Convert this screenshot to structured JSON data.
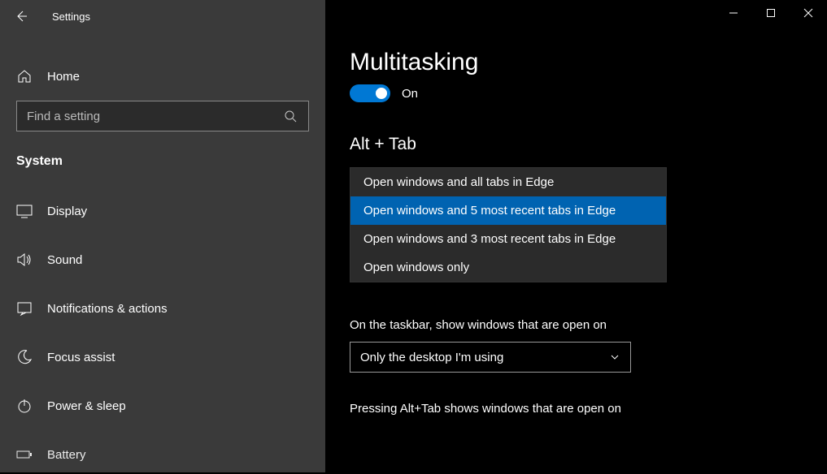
{
  "app": {
    "title": "Settings"
  },
  "sidebar": {
    "home": "Home",
    "searchPlaceholder": "Find a setting",
    "category": "System",
    "items": [
      {
        "label": "Display"
      },
      {
        "label": "Sound"
      },
      {
        "label": "Notifications & actions"
      },
      {
        "label": "Focus assist"
      },
      {
        "label": "Power & sleep"
      },
      {
        "label": "Battery"
      }
    ]
  },
  "main": {
    "title": "Multitasking",
    "toggleState": "On",
    "altTab": {
      "heading": "Alt + Tab",
      "options": [
        "Open windows and all tabs in Edge",
        "Open windows and 5 most recent tabs in Edge",
        "Open windows and 3 most recent tabs in Edge",
        "Open windows only"
      ],
      "selectedIndex": 1
    },
    "virtualDesktops": {
      "taskbarLabel": "On the taskbar, show windows that are open on",
      "taskbarValue": "Only the desktop I'm using",
      "altTabLabel": "Pressing Alt+Tab shows windows that are open on"
    }
  }
}
